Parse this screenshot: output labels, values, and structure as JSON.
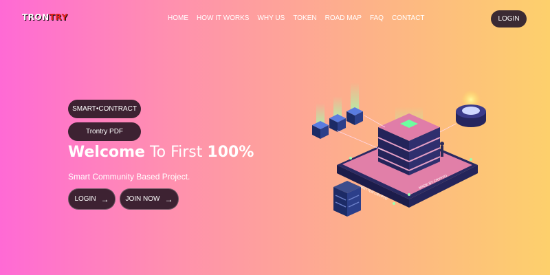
{
  "logo": {
    "part1": "TRON",
    "part2": "TRY"
  },
  "nav": [
    "HOME",
    "HOW IT WORKS",
    "WHY US",
    "TOKEN",
    "ROAD MAP",
    "FAQ",
    "CONTACT"
  ],
  "header": {
    "login_label": "LOGIN"
  },
  "hero": {
    "smart_contract_label": "SMART•CONTRACT",
    "pdf_label": "Trontry PDF",
    "headline_bold1": "Welcome",
    "headline_mid": " To First ",
    "headline_bold2": "100%",
    "subtitle": "Smart Community Based Project.",
    "login_label": "LOGIN",
    "join_label": "JOIN NOW",
    "arrow": "→"
  },
  "colors": {
    "gradient_start": "#ff6ad5",
    "gradient_end": "#fdd06c",
    "button_dark": "#3d2232",
    "logo_accent": "#e8231f"
  },
  "icons": [
    "arrow-right-icon",
    "server-illustration"
  ]
}
